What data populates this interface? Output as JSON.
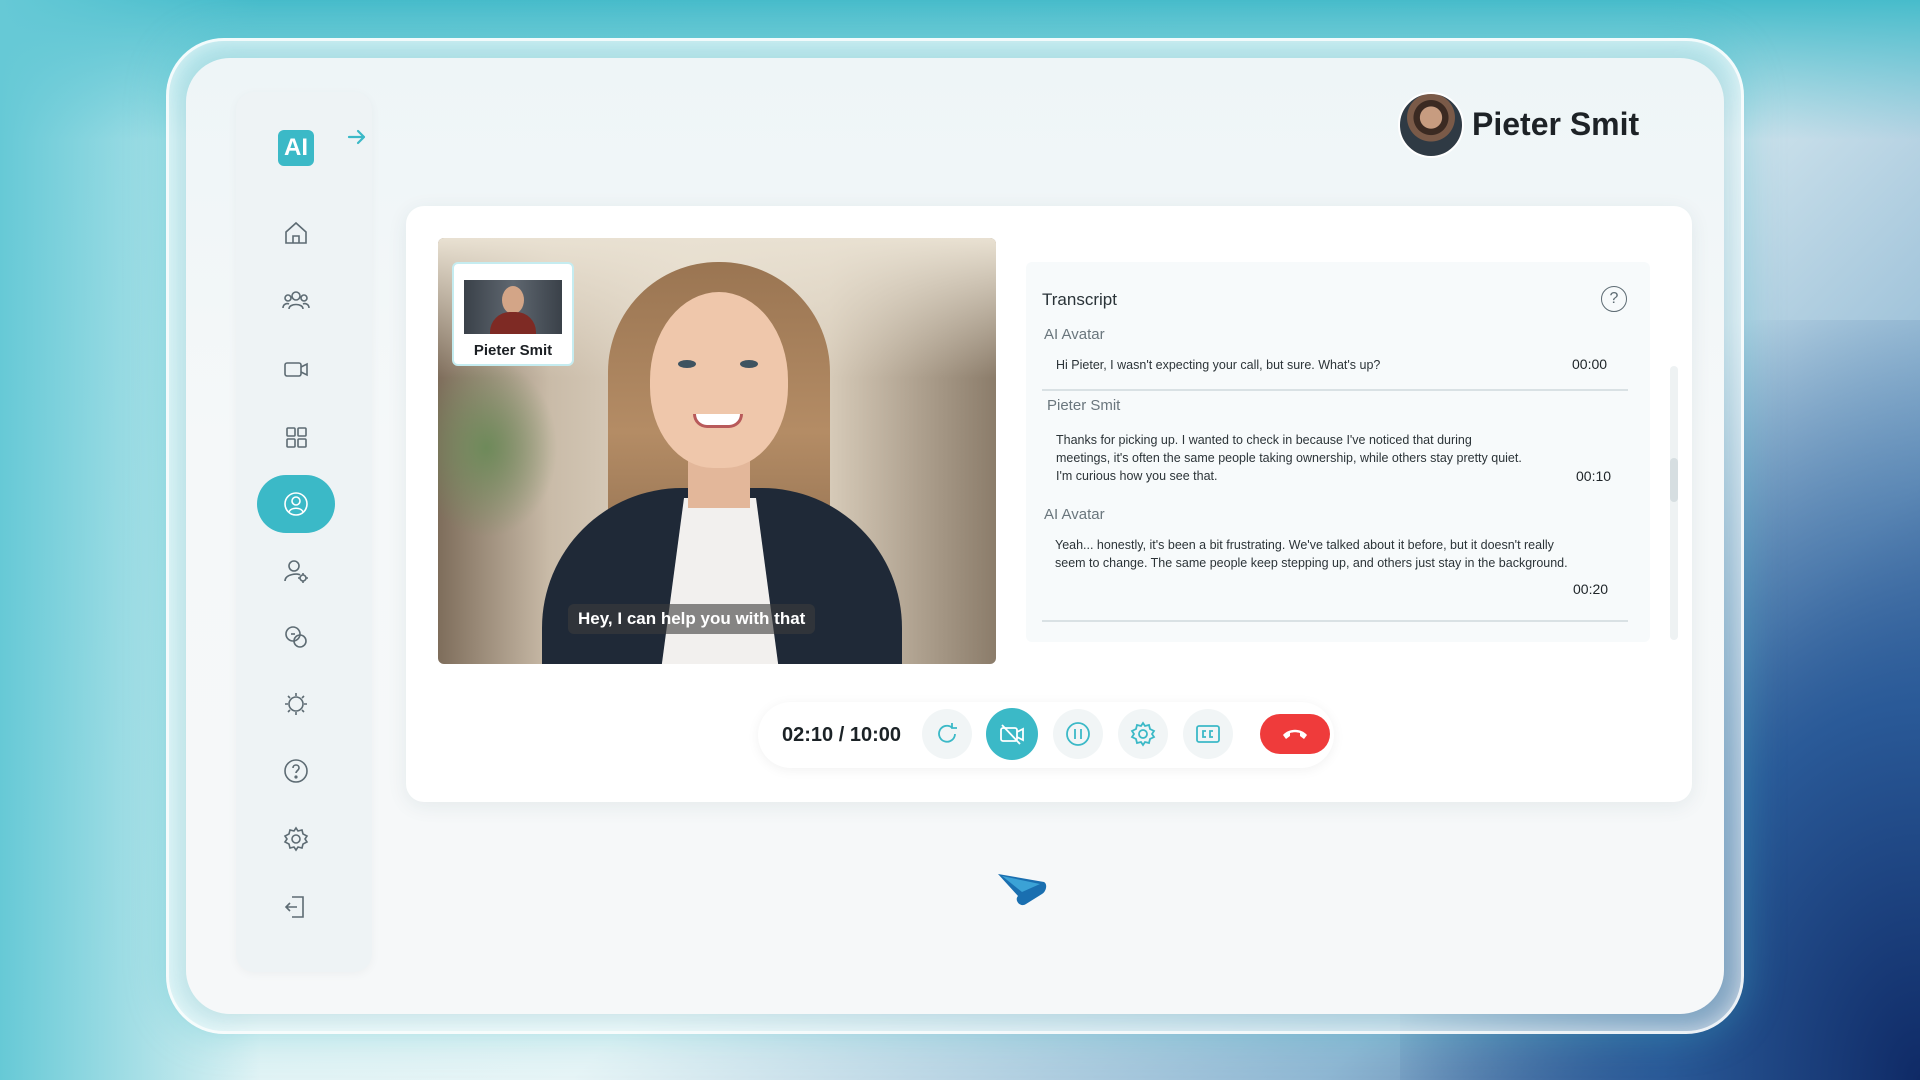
{
  "app": {
    "logo_text": "AI",
    "accent_color": "#3bb9c7",
    "end_call_color": "#ef3b3b"
  },
  "sidebar": {
    "expand_icon": "arrow-right-icon",
    "items": [
      {
        "name": "home",
        "icon": "home-icon",
        "active": false
      },
      {
        "name": "teams",
        "icon": "users-icon",
        "active": false
      },
      {
        "name": "video",
        "icon": "video-icon",
        "active": false
      },
      {
        "name": "dashboard",
        "icon": "grid-icon",
        "active": false
      },
      {
        "name": "ai-avatar",
        "icon": "avatar-icon",
        "active": true
      },
      {
        "name": "user-settings",
        "icon": "user-gear-icon",
        "active": false
      },
      {
        "name": "scenarios",
        "icon": "chat-bubbles-icon",
        "active": false
      },
      {
        "name": "cms",
        "icon": "cms-gear-icon",
        "active": false
      },
      {
        "name": "help",
        "icon": "help-icon",
        "active": false
      },
      {
        "name": "settings",
        "icon": "gear-icon",
        "active": false
      },
      {
        "name": "logout",
        "icon": "logout-icon",
        "active": false
      }
    ]
  },
  "header": {
    "user_name": "Pieter Smit"
  },
  "video": {
    "pip_name": "Pieter Smit",
    "caption": "Hey, I can help you with that"
  },
  "transcript": {
    "title": "Transcript",
    "entries": [
      {
        "speaker": "AI Avatar",
        "text": "Hi Pieter, I wasn't expecting your call, but sure. What's up?",
        "time": "00:00"
      },
      {
        "speaker": "Pieter Smit",
        "text": "Thanks for picking up. I wanted to check in because I've noticed that during meetings, it's often the same people taking ownership, while others stay pretty quiet. I'm curious how you see that.",
        "time": "00:10"
      },
      {
        "speaker": "AI Avatar",
        "text": "Yeah... honestly, it's been a bit frustrating. We've talked about it before, but it doesn't really seem to change. The same people keep stepping up, and others just stay in the background.",
        "time": "00:20"
      }
    ]
  },
  "controls": {
    "timer": "02:10 / 10:00",
    "buttons": [
      "refresh-icon",
      "video-off-icon",
      "pause-icon",
      "gear-icon",
      "cc-icon",
      "end-call-icon"
    ],
    "active_button": "video-off-icon"
  }
}
